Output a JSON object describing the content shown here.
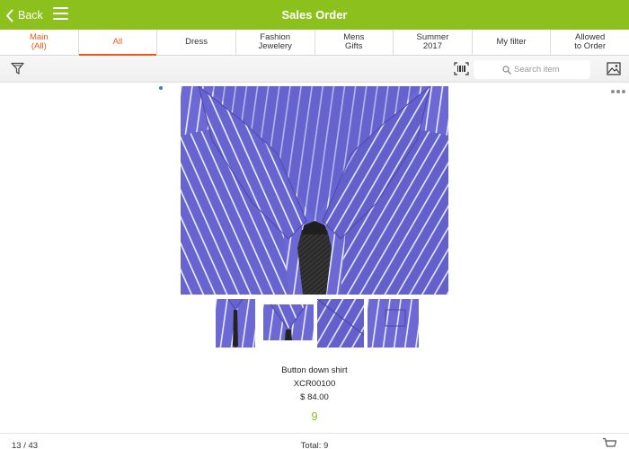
{
  "header": {
    "back_label": "Back",
    "title": "Sales Order",
    "color": "#8cc11d"
  },
  "tabs": [
    {
      "label": "Main\n(All)",
      "state": "main"
    },
    {
      "label": "All",
      "state": "active"
    },
    {
      "label": "Dress",
      "state": ""
    },
    {
      "label": "Fashion\nJewelery",
      "state": ""
    },
    {
      "label": "Mens\nGifts",
      "state": ""
    },
    {
      "label": "Summer\n2017",
      "state": ""
    },
    {
      "label": "My filter",
      "state": ""
    },
    {
      "label": "Allowed\nto Order",
      "state": ""
    }
  ],
  "toolbar": {
    "search_placeholder": "Search item",
    "icons": [
      "filter-icon",
      "barcode-scan-icon",
      "search-icon",
      "image-view-icon"
    ]
  },
  "product": {
    "name": "Button down shirt",
    "code": "XCR00100",
    "price": "$ 84.00",
    "quantity": "9",
    "thumbnail_count": 4
  },
  "footer": {
    "page_count": "13 / 43",
    "total": "Total: 9"
  },
  "colors": {
    "accent": "#e85a16",
    "brand_green": "#8cc11d",
    "shirt_blue": "#6a66d2"
  }
}
